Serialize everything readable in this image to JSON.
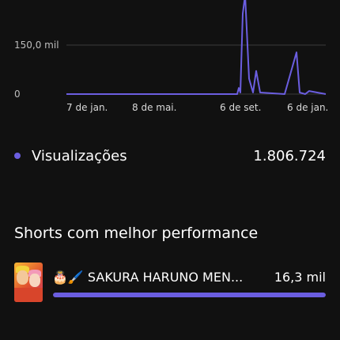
{
  "chart_data": {
    "type": "line",
    "series": [
      {
        "values": [
          [
            "7 de jan.",
            0
          ],
          [
            "8 de mai.",
            0
          ],
          [
            "late aug",
            0
          ],
          [
            "late aug",
            20
          ],
          [
            "late aug+1",
            5
          ],
          [
            "late aug+2",
            260
          ],
          [
            "peak",
            320
          ],
          [
            "after peak",
            50
          ],
          [
            "after peak2",
            5
          ],
          [
            "6 de set.",
            75
          ],
          [
            "mid sep",
            5
          ],
          [
            "nov",
            0
          ],
          [
            "late nov",
            135
          ],
          [
            "late nov+1",
            5
          ],
          [
            "dec",
            0
          ],
          [
            "dec+1",
            10
          ],
          [
            "end",
            0
          ]
        ]
      }
    ],
    "y_ticks": [
      "0",
      "150,0 mil"
    ],
    "x_ticks": [
      "7 de jan.",
      "8 de mai.",
      "6 de set.",
      "6 de jan."
    ],
    "ylim": [
      0,
      330
    ],
    "grid": true
  },
  "colors": {
    "accent": "#6b5ee0",
    "background": "#111111",
    "grid": "#3a3a3a"
  },
  "metric": {
    "label": "Visualizações",
    "value": "1.806.724"
  },
  "section": {
    "title": "Shorts com melhor performance"
  },
  "shorts": [
    {
      "title": "🎂🖌️ SAKURA HARUNO MEN...",
      "views": "16,3 mil",
      "share": 1.0
    }
  ]
}
